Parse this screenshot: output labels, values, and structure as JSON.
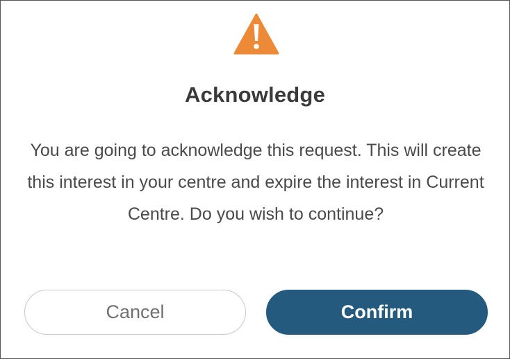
{
  "dialog": {
    "icon": "warning-triangle-icon",
    "title": "Acknowledge",
    "message": "You are going to acknowledge this request. This will create this interest in your centre and expire the interest in Current Centre. Do you wish to continue?",
    "cancel_label": "Cancel",
    "confirm_label": "Confirm"
  },
  "colors": {
    "warning": "#ec8a37",
    "confirm_bg": "#235a7e",
    "title_text": "#3a3a3a",
    "body_text": "#4a4a4a"
  }
}
